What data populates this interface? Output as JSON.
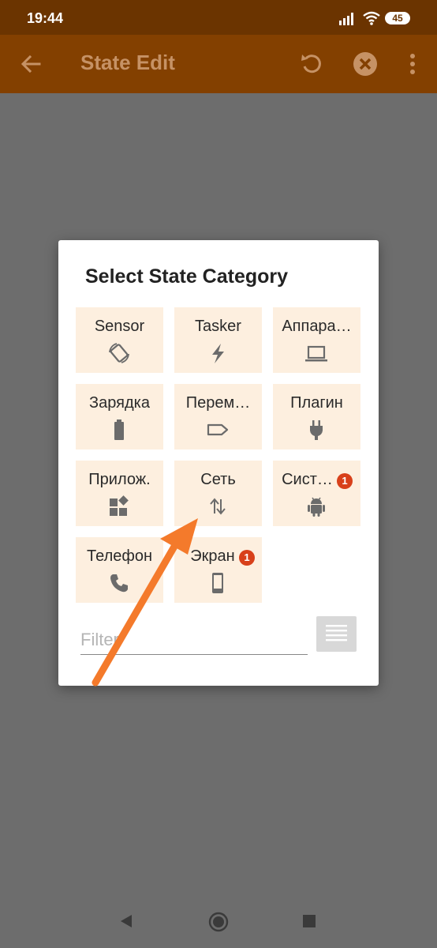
{
  "status_bar": {
    "time": "19:44",
    "battery": "45"
  },
  "toolbar": {
    "title": "State Edit",
    "back_icon": "arrow-left-icon",
    "undo_icon": "undo-icon",
    "cancel_icon": "cancel-circle-icon",
    "menu_icon": "more-vert-icon"
  },
  "dialog": {
    "title": "Select State Category",
    "tiles": [
      {
        "label": "Sensor",
        "icon": "screen-rotation-icon"
      },
      {
        "label": "Tasker",
        "icon": "lightning-icon"
      },
      {
        "label": "Аппара…",
        "icon": "laptop-icon"
      },
      {
        "label": "Зарядка",
        "icon": "battery-icon"
      },
      {
        "label": "Перем…",
        "icon": "label-tag-icon"
      },
      {
        "label": "Плагин",
        "icon": "power-plug-icon"
      },
      {
        "label": "Прилож.",
        "icon": "widgets-icon"
      },
      {
        "label": "Сеть",
        "icon": "swap-vertical-icon"
      },
      {
        "label": "Сист…",
        "icon": "android-icon",
        "badge": "1"
      },
      {
        "label": "Телефон",
        "icon": "phone-icon"
      },
      {
        "label": "Экран",
        "icon": "smartphone-icon",
        "badge": "1"
      }
    ],
    "filter_placeholder": "Filter",
    "list_button_icon": "list-lines-icon"
  },
  "annotation": {
    "arrow_color": "#f47a2b"
  },
  "nav_bar": {
    "back_icon": "nav-back-icon",
    "home_icon": "nav-home-icon",
    "recents_icon": "nav-recents-icon"
  },
  "colors": {
    "status_bar": "#6b3400",
    "toolbar": "#834000",
    "tile_bg": "#fdefdf",
    "badge": "#d8401a",
    "backdrop": "#6d6d6d"
  }
}
